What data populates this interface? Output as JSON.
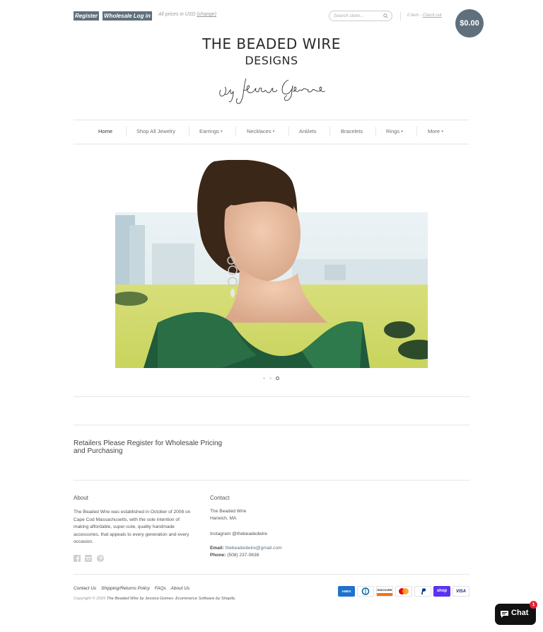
{
  "header": {
    "register_label": "Register",
    "wholesale_login_label": "Wholesale Log in",
    "prices_text": "All prices in USD",
    "change_label": "(change)",
    "search_placeholder": "Search store...",
    "cart_items": "0 item",
    "cart_sep": " - ",
    "checkout_label": "Check out",
    "cart_total": "$0.00"
  },
  "logo": {
    "line1": "THE BEADED WIRE",
    "line2": "DESIGNS",
    "signature": "by Jessica Gomes"
  },
  "nav": {
    "items": [
      {
        "label": "Home",
        "active": true,
        "dropdown": false
      },
      {
        "label": "Shop All Jewelry",
        "active": false,
        "dropdown": false
      },
      {
        "label": "Earrings",
        "active": false,
        "dropdown": true
      },
      {
        "label": "Necklaces",
        "active": false,
        "dropdown": true
      },
      {
        "label": "Anklets",
        "active": false,
        "dropdown": false
      },
      {
        "label": "Bracelets",
        "active": false,
        "dropdown": false
      },
      {
        "label": "Rings",
        "active": false,
        "dropdown": true
      },
      {
        "label": "More",
        "active": false,
        "dropdown": true
      }
    ],
    "caret": "▾"
  },
  "slideshow": {
    "slide_count": 3,
    "active_slide": 3
  },
  "wholesale_notice": "Retailers Please Register for Wholesale Pricing and Purchasing",
  "footer": {
    "about_heading": "About",
    "about_text": "The Beaded Wire was established in October of 2008 on Cape Cod Massachusetts, with the sole intention of making affordable, super-cute, quality handmade accessories, that appeals to every generation and every occasion.",
    "contact_heading": "Contact",
    "contact_name": "The Beaded Wire",
    "contact_city": "Harwich, MA",
    "instagram": "Instagram @thebeadedwire",
    "email_label": "Email:",
    "email_value": "thebeadedwire@gmail.com",
    "phone_label": "Phone:",
    "phone_value": "(508) 237-0638",
    "links": [
      "Contact Us",
      "Shipping/Returns Policy",
      "FAQs",
      "About Us"
    ],
    "copyright_prefix": "Copyright © 2025",
    "copyright_store": "The Beaded Wire by Jessica Gomes",
    "copyright_suffix": "Ecommerce Software by Shopify.",
    "social_icons": [
      "facebook-icon",
      "instagram-icon",
      "pinterest-icon"
    ]
  },
  "payments": [
    "AMEX",
    "Diners",
    "DISCOVER",
    "Mastercard",
    "PayPal",
    "shop",
    "VISA"
  ],
  "chat": {
    "label": "Chat",
    "badge": "1"
  },
  "colors": {
    "accent": "#5f707c",
    "chat_bg": "#111111",
    "badge_red": "#e0253a"
  }
}
